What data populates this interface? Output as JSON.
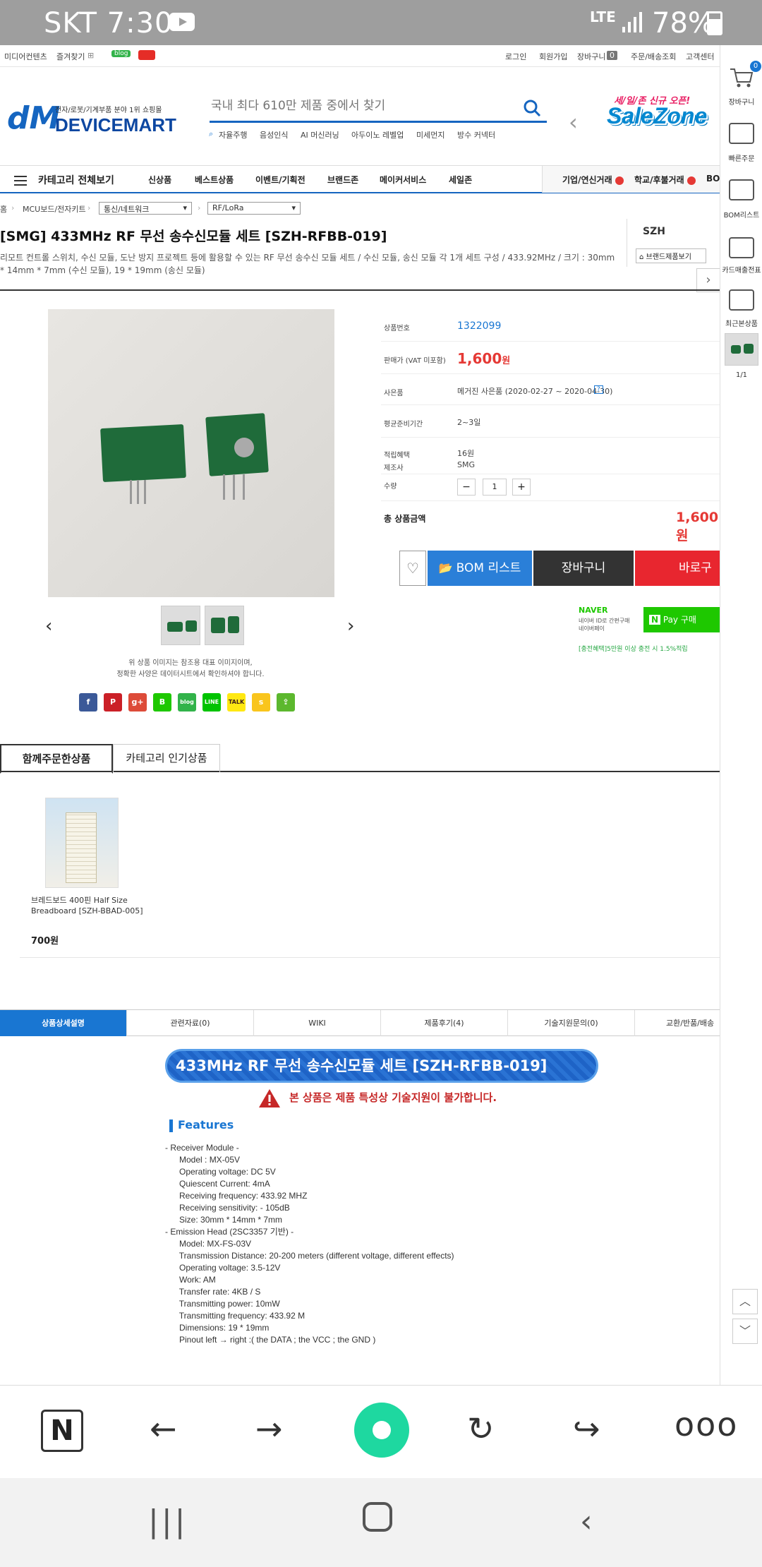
{
  "status": {
    "time": "SKT 7:30",
    "network": "LTE",
    "battery": "78%"
  },
  "util": {
    "left": [
      "미디어컨텐츠",
      "즐겨찾기"
    ],
    "blog": "blog",
    "right": [
      "로그인",
      "회원가입",
      "장바구니",
      "주문/배송조회",
      "고객센터"
    ],
    "cart_count": "0"
  },
  "logo": {
    "mark": "dM",
    "text": "DEVICEMART",
    "sub": "전자/로봇/기계부품 분야 1위 쇼핑몰"
  },
  "search": {
    "placeholder": "국내 최다 610만 제품 중에서 찾기",
    "keywords": [
      "자율주행",
      "음성인식",
      "AI 머신러닝",
      "아두이노 레벨업",
      "미세먼지",
      "방수 커넥터"
    ]
  },
  "salezone": {
    "line1": "세/일/존 신규 오픈!",
    "line2": "SaleZone"
  },
  "catbar": {
    "all": "카테고리 전체보기",
    "menu": [
      "신상품",
      "베스트상품",
      "이벤트/기획전",
      "브랜드존",
      "메이커서비스",
      "세일존"
    ],
    "right": [
      "기업/연신거래",
      "학교/후불거래",
      "BO"
    ]
  },
  "side": {
    "cart": "장바구니",
    "cart_count": "0",
    "quick": "빠른주문",
    "bom": "BOM리스트",
    "card": "카드매출전표",
    "recent": "최근본상품",
    "page": "1/1"
  },
  "breadcrumb": {
    "home": "홈",
    "l1": "MCU보드/전자키트",
    "l2": "통신/네트워크",
    "l3": "RF/LoRa"
  },
  "product": {
    "title": "[SMG] 433MHz RF 무선 송수신모듈 세트 [SZH-RFBB-019]",
    "desc": "리모트 컨트롤 스위치, 수신 모듈, 도난 방지 프로젝트 등에 활용할 수 있는 RF 무선 송수신 모듈 세트 / 수신 모듈, 송신 모듈 각 1개 세트 구성 / 433.92MHz / 크기 : 30mm * 14mm * 7mm (수신 모듈), 19 * 19mm (송신 모듈)",
    "brand": "SZH",
    "brand_btn": "브랜드제품보기",
    "notice": "위 상품 이미지는 참조용 대표 이미지이며,\n정확한 사양은 데이터시트에서 확인하셔야 합니다."
  },
  "info": {
    "code_label": "상품번호",
    "code": "1322099",
    "price_label": "판매가 (VAT 미포함)",
    "price": "1,600",
    "price_unit": "원",
    "gift_label": "사은품",
    "gift": "메거진 사은품 (2020-02-27 ~ 2020-04-30)",
    "ship_label": "평균준비기간",
    "ship": "2~3일",
    "point_label": "적립혜택",
    "point": "16원",
    "maker_label": "제조사",
    "maker": "SMG",
    "qty_label": "수량",
    "qty": "1",
    "total_label": "총 상품금액",
    "total": "1,600원"
  },
  "buttons": {
    "bom": "BOM 리스트",
    "cart": "장바구니",
    "buy": "바로구매"
  },
  "naver": {
    "logo": "NAVER",
    "text": "네이버 ID로 간편구매\n네이버페이",
    "pay": "Pay 구매",
    "note": "[충전혜택]5만원 이상 충전 시 1.5%적립"
  },
  "tabs": {
    "t1": "함께주문한상품",
    "t2": "카테고리 인기상품"
  },
  "related": {
    "name": "브레드보드 400핀 Half Size Breadboard [SZH-BBAD-005]",
    "price": "700원"
  },
  "dtabs": [
    "상품상세설명",
    "관련자료(0)",
    "WIKI",
    "제품후기(4)",
    "기술지원문의(0)",
    "교환/반품/배송"
  ],
  "detail": {
    "banner": "433MHz RF 무선 송수신모듈 세트 [SZH-RFBB-019]",
    "warn": "본 상품은 제품 특성상 기술지원이 불가합니다.",
    "features": "Features",
    "spec": "- Receiver Module -\n      Model : MX-05V\n      Operating voltage: DC 5V\n      Quiescent Current: 4mA\n      Receiving frequency: 433.92 MHZ\n      Receiving sensitivity: - 105dB\n      Size: 30mm * 14mm * 7mm\n- Emission Head (2SC3357 기반) -\n      Model: MX-FS-03V\n      Transmission Distance: 20-200 meters (different voltage, different effects)\n      Operating voltage: 3.5-12V\n      Work: AM\n      Transfer rate: 4KB / S\n      Transmitting power: 10mW\n      Transmitting frequency: 433.92 M\n      Dimensions: 19 * 19mm\n      Pinout left → right :( the DATA ; the VCC ; the GND )"
  }
}
